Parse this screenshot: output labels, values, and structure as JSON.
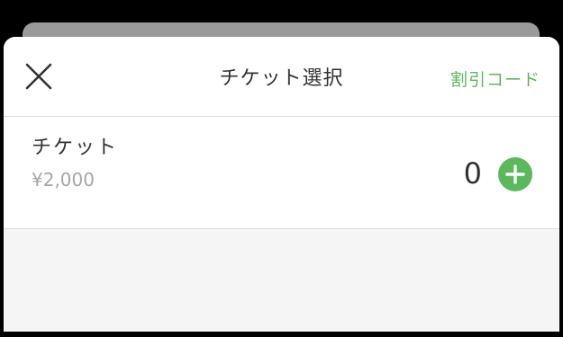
{
  "header": {
    "title": "チケット選択",
    "discount_code_label": "割引コード",
    "close_icon": "close-icon"
  },
  "tickets": [
    {
      "name": "チケット",
      "price": "¥2,000",
      "quantity": "0",
      "add_icon": "plus-circle-icon"
    }
  ],
  "colors": {
    "accent": "#5cb85c",
    "text": "#333333",
    "muted": "#a6a6a6",
    "backdrop": "#000000",
    "sheet_background": "#f5f5f5"
  }
}
